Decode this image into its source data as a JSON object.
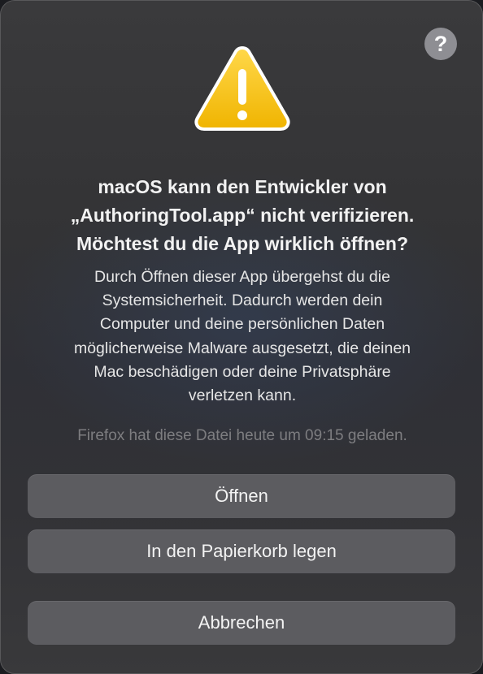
{
  "dialog": {
    "help_label": "?",
    "title_lines": [
      "macOS kann den Entwickler von",
      "„AuthoringTool.app“ nicht verifizieren.",
      "Möchtest du die App wirklich öffnen?"
    ],
    "body_lines": [
      "Durch Öffnen dieser App übergehst du die",
      "Systemsicherheit. Dadurch werden dein",
      "Computer und deine persönlichen Daten",
      "möglicherweise Malware ausgesetzt, die deinen",
      "Mac beschädigen oder deine Privatsphäre",
      "verletzen kann."
    ],
    "download_note": "Firefox hat diese Datei heute um 09:15 geladen.",
    "buttons": {
      "open": "Öffnen",
      "trash": "In den Papierkorb legen",
      "cancel": "Abbrechen"
    },
    "icon": "warning-triangle-icon",
    "colors": {
      "icon_yellow": "#f5c518",
      "button_bg": "#5c5c60",
      "help_bg": "#8e8e93"
    }
  }
}
